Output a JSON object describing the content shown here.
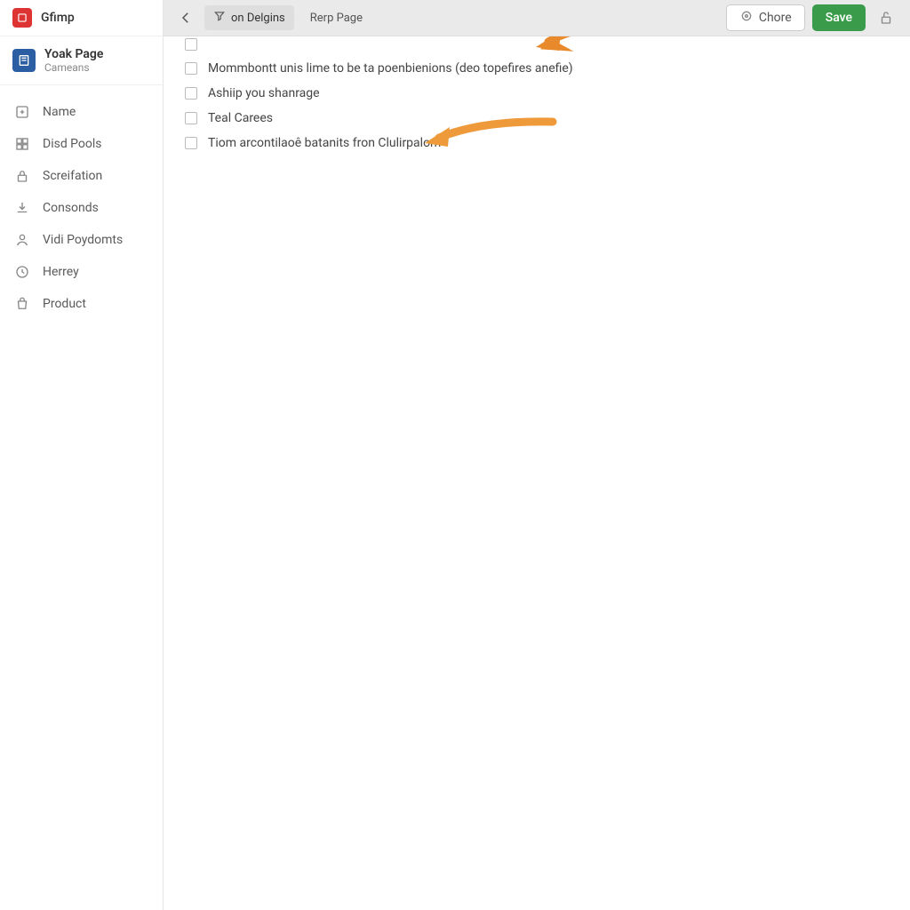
{
  "brand": {
    "label": "Gfimp"
  },
  "page": {
    "title": "Yoak Page",
    "subtitle": "Cameans"
  },
  "nav": {
    "items": [
      {
        "label": "Name"
      },
      {
        "label": "Disd Pools"
      },
      {
        "label": "Screifation"
      },
      {
        "label": "Consonds"
      },
      {
        "label": "Vidi Poydomts"
      },
      {
        "label": "Herrey"
      },
      {
        "label": "Product"
      }
    ]
  },
  "topbar": {
    "chip_label": "on Delgins",
    "tab_label": "Rerp Page",
    "chore_label": "Chore",
    "save_label": "Save"
  },
  "checks": {
    "items": [
      {
        "label": ""
      },
      {
        "label": "Mommbontt unis lime to be ta poenbienions (deo topefires anefie)"
      },
      {
        "label": "Ashiip you shanrage"
      },
      {
        "label": "Teal Carees"
      },
      {
        "label": "Tiom arcontilaoê batanits fron Clulirpalom"
      }
    ]
  }
}
